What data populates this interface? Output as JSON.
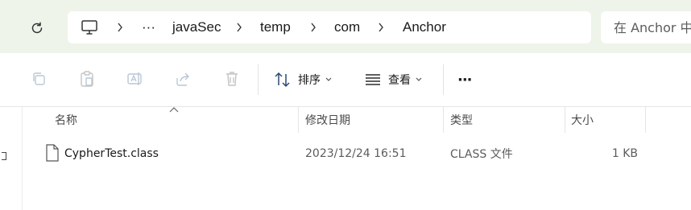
{
  "address_bar": {
    "breadcrumbs": [
      "javaSec",
      "temp",
      "com",
      "Anchor"
    ],
    "overflow_label": "···",
    "search_placeholder": "在 Anchor 中搜索"
  },
  "toolbar": {
    "sort_label": "排序",
    "view_label": "查看",
    "more_label": "···"
  },
  "columns": {
    "name": "名称",
    "date": "修改日期",
    "type": "类型",
    "size": "大小"
  },
  "files": [
    {
      "name": "CypherTest.class",
      "modified": "2023/12/24 16:51",
      "type": "CLASS 文件",
      "size": "1 KB"
    }
  ],
  "icons": {
    "refresh": "refresh-icon",
    "this_pc": "monitor-icon",
    "copy": "copy-icon",
    "paste": "paste-icon",
    "rename": "rename-icon",
    "share": "share-icon",
    "delete": "trash-icon",
    "sort": "sort-icon",
    "view": "view-list-icon",
    "file": "file-icon"
  }
}
